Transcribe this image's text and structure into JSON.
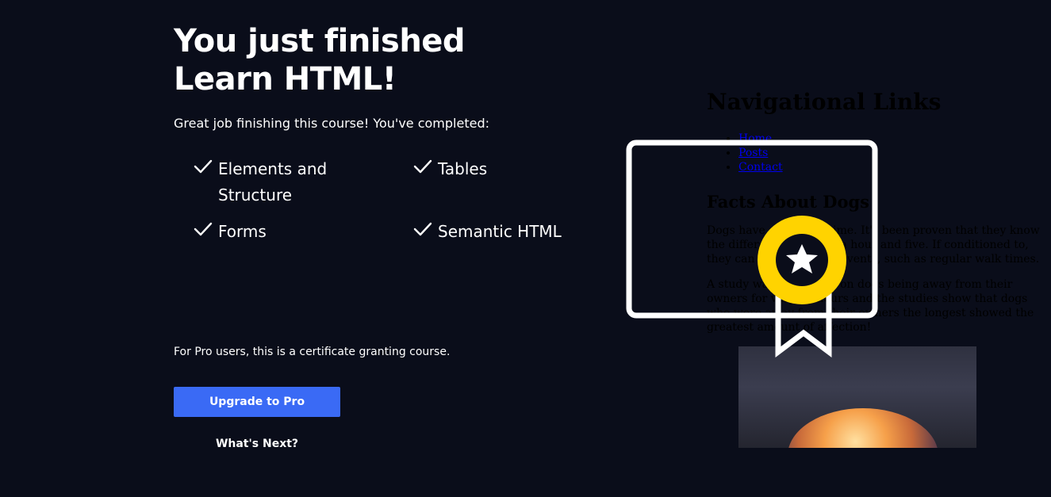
{
  "heading": {
    "line1": "You just finished",
    "line2": "Learn HTML!"
  },
  "subtitle": "Great job finishing this course! You've completed:",
  "skills": [
    {
      "label": "Elements and Structure"
    },
    {
      "label": "Tables"
    },
    {
      "label": "Forms"
    },
    {
      "label": "Semantic HTML"
    }
  ],
  "pro_note": "For Pro users, this is a certificate granting course.",
  "upgrade_button": "Upgrade to Pro",
  "next_link": "What's Next?",
  "preview": {
    "title": "Navigational Links",
    "nav": [
      "Home",
      "Posts",
      "Contact"
    ],
    "section_title": "Facts About Dogs",
    "paragraphs": [
      "Dogs have a sense of time. It's been proven that they know the difference between a hour and five. If conditioned to, they can predict future events, such as regular walk times.",
      "A study was conducted on dogs being away from their owners for varying hours and the studies show that dogs who were away from their owners the longest showed the greatest amount of affection!"
    ]
  },
  "colors": {
    "background": "#0a0d1a",
    "button": "#3a6af5",
    "badge": "#ffd300"
  },
  "icons": {
    "check": "checkmark-icon",
    "certificate": "certificate-icon"
  }
}
